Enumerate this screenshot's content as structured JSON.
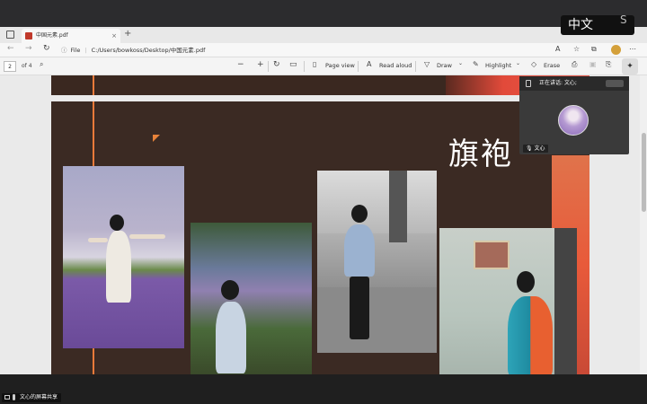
{
  "overlay": {
    "language_label": "中文",
    "logo": "S"
  },
  "browser": {
    "tab_title": "中国元素.pdf",
    "tab_close": "×",
    "new_tab": "+",
    "url_prefix": "File",
    "url_path": "C:/Users/bowkoss/Desktop/中国元素.pdf"
  },
  "pdf_toolbar": {
    "page_current": "2",
    "page_total": "of 4",
    "page_view_label": "Page view",
    "read_aloud_label": "Read aloud",
    "draw_label": "Draw",
    "highlight_label": "Highlight",
    "erase_label": "Erase"
  },
  "slide": {
    "title": "旗袍"
  },
  "meeting_panel": {
    "header_text": "正在讲话: 文心;",
    "participant_name": "文心"
  },
  "status": {
    "screen_share_text": "文心的屏幕共享"
  }
}
